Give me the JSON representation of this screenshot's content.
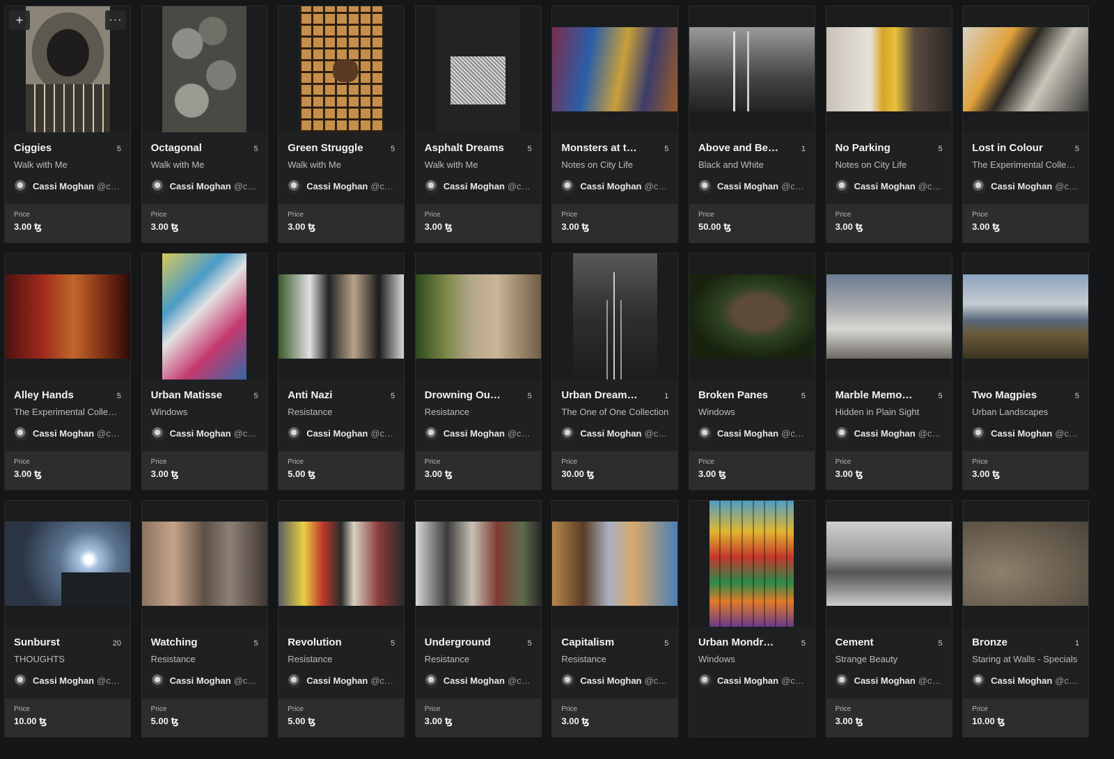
{
  "ui": {
    "add_glyph": "+",
    "more_glyph": "···",
    "price_label": "Price",
    "creator_name": "Cassi Moghan",
    "creator_handle": "@cas…"
  },
  "cards": [
    {
      "title": "Ciggies",
      "edition": "5",
      "collection": "Walk with Me",
      "price": "3.00 ꜩ",
      "orientation": "portrait",
      "art": "a1"
    },
    {
      "title": "Octagonal",
      "edition": "5",
      "collection": "Walk with Me",
      "price": "3.00 ꜩ",
      "orientation": "portrait",
      "art": "a2"
    },
    {
      "title": "Green Struggle",
      "edition": "5",
      "collection": "Walk with Me",
      "price": "3.00 ꜩ",
      "orientation": "portrait",
      "art": "a3"
    },
    {
      "title": "Asphalt Dreams",
      "edition": "5",
      "collection": "Walk with Me",
      "price": "3.00 ꜩ",
      "orientation": "portrait",
      "art": "a4"
    },
    {
      "title": "Monsters at t…",
      "edition": "5",
      "collection": "Notes on City Life",
      "price": "3.00 ꜩ",
      "orientation": "landscape",
      "art": "a5"
    },
    {
      "title": "Above and Be…",
      "edition": "1",
      "collection": "Black and White",
      "price": "50.00 ꜩ",
      "orientation": "landscape",
      "art": "a6"
    },
    {
      "title": "No Parking",
      "edition": "5",
      "collection": "Notes on City Life",
      "price": "3.00 ꜩ",
      "orientation": "landscape",
      "art": "a7"
    },
    {
      "title": "Lost in Colour",
      "edition": "5",
      "collection": "The Experimental Collec…",
      "price": "3.00 ꜩ",
      "orientation": "landscape",
      "art": "a8"
    },
    {
      "title": "Alley Hands",
      "edition": "5",
      "collection": "The Experimental Collec…",
      "price": "3.00 ꜩ",
      "orientation": "landscape",
      "art": "b1"
    },
    {
      "title": "Urban Matisse",
      "edition": "5",
      "collection": "Windows",
      "price": "3.00 ꜩ",
      "orientation": "portrait",
      "art": "b2"
    },
    {
      "title": "Anti Nazi",
      "edition": "5",
      "collection": "Resistance",
      "price": "5.00 ꜩ",
      "orientation": "landscape",
      "art": "b3"
    },
    {
      "title": "Drowning Ou…",
      "edition": "5",
      "collection": "Resistance",
      "price": "3.00 ꜩ",
      "orientation": "landscape",
      "art": "b4"
    },
    {
      "title": "Urban Dream…",
      "edition": "1",
      "collection": "The One of One Collection",
      "price": "30.00 ꜩ",
      "orientation": "portrait",
      "art": "b5"
    },
    {
      "title": "Broken Panes",
      "edition": "5",
      "collection": "Windows",
      "price": "3.00 ꜩ",
      "orientation": "landscape",
      "art": "b6"
    },
    {
      "title": "Marble Memo…",
      "edition": "5",
      "collection": "Hidden in Plain Sight",
      "price": "3.00 ꜩ",
      "orientation": "landscape",
      "art": "b7"
    },
    {
      "title": "Two Magpies",
      "edition": "5",
      "collection": "Urban Landscapes",
      "price": "3.00 ꜩ",
      "orientation": "landscape",
      "art": "b8"
    },
    {
      "title": "Sunburst",
      "edition": "20",
      "collection": "THOUGHTS",
      "price": "10.00 ꜩ",
      "orientation": "landscape",
      "art": "c1"
    },
    {
      "title": "Watching",
      "edition": "5",
      "collection": "Resistance",
      "price": "5.00 ꜩ",
      "orientation": "landscape",
      "art": "c2"
    },
    {
      "title": "Revolution",
      "edition": "5",
      "collection": "Resistance",
      "price": "5.00 ꜩ",
      "orientation": "landscape",
      "art": "c3"
    },
    {
      "title": "Underground",
      "edition": "5",
      "collection": "Resistance",
      "price": "3.00 ꜩ",
      "orientation": "landscape",
      "art": "c4"
    },
    {
      "title": "Capitalism",
      "edition": "5",
      "collection": "Resistance",
      "price": "3.00 ꜩ",
      "orientation": "landscape",
      "art": "c5"
    },
    {
      "title": "Urban Mondr…",
      "edition": "5",
      "collection": "Windows",
      "price": "",
      "orientation": "portrait",
      "art": "c6"
    },
    {
      "title": "Cement",
      "edition": "5",
      "collection": "Strange Beauty",
      "price": "3.00 ꜩ",
      "orientation": "landscape",
      "art": "c7"
    },
    {
      "title": "Bronze",
      "edition": "1",
      "collection": "Staring at Walls - Specials",
      "price": "10.00 ꜩ",
      "orientation": "landscape",
      "art": "c8"
    }
  ]
}
